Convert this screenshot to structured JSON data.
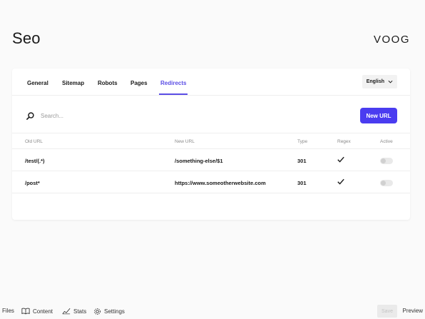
{
  "header": {
    "title": "Seo",
    "logo_text": "VOOG"
  },
  "tabs": [
    {
      "label": "General",
      "active": false
    },
    {
      "label": "Sitemap",
      "active": false
    },
    {
      "label": "Robots",
      "active": false
    },
    {
      "label": "Pages",
      "active": false
    },
    {
      "label": "Redirects",
      "active": true
    }
  ],
  "language": {
    "selected": "English",
    "icon": "chevron-down-icon"
  },
  "search": {
    "placeholder": "Search...",
    "value": "",
    "icon": "search-icon"
  },
  "new_url_button": "New URL",
  "table": {
    "columns": [
      "Old URL",
      "New URL",
      "Type",
      "Regex",
      "Active"
    ],
    "rows": [
      {
        "old_url": "/test/(.*)",
        "new_url": "/something-else/$1",
        "type": "301",
        "regex": true,
        "active": false
      },
      {
        "old_url": "/post*",
        "new_url": "https://www.someotherwebsite.com",
        "type": "301",
        "regex": true,
        "active": false
      }
    ]
  },
  "bottom_bar": {
    "files": "Files",
    "content": "Content",
    "stats": "Stats",
    "settings": "Settings",
    "save": "Save",
    "preview": "Preview"
  },
  "colors": {
    "accent": "#4a3cf0",
    "tab_active": "#5b4ee5",
    "background": "#fafafa"
  }
}
